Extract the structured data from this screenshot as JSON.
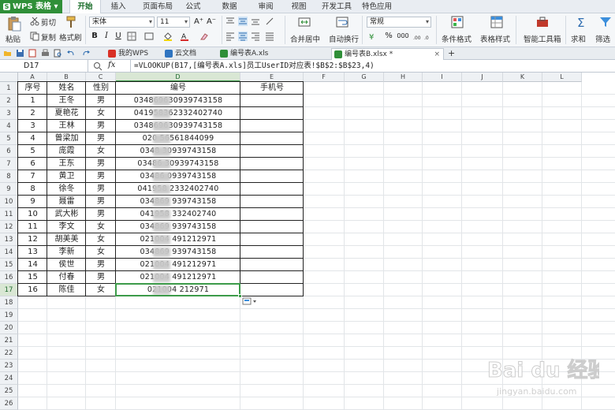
{
  "app": {
    "name": "WPS 表格"
  },
  "menu": {
    "tabs": [
      "开始",
      "插入",
      "页面布局",
      "公式",
      "数据",
      "审阅",
      "视图",
      "开发工具",
      "特色应用"
    ],
    "active": 0
  },
  "ribbon": {
    "paste": "粘贴",
    "cut": "剪切",
    "copy": "复制",
    "format_painter": "格式刷",
    "font_name": "宋体",
    "font_size": "11",
    "merge_center": "合并居中",
    "wrap_text": "自动换行",
    "number_format": "常规",
    "conditional_format": "条件格式",
    "table_style": "表格样式",
    "smart_toolbox": "智能工具箱",
    "sum": "求和",
    "filter": "筛选",
    "font_grow": "A⁺",
    "font_shrink": "A⁻",
    "bold": "B",
    "italic": "I",
    "underline": "U",
    "percent": "%",
    "comma": "000"
  },
  "doc_tabs": [
    {
      "label": "我的WPS",
      "color": "#d93025"
    },
    {
      "label": "云文档",
      "color": "#2f74c0"
    },
    {
      "label": "编号表A.xls",
      "color": "#2f8f38"
    },
    {
      "label": "编号表B.xlsx *",
      "color": "#2f8f38"
    }
  ],
  "doc_tab_close": "×",
  "doc_tab_add": "+",
  "formula_bar": {
    "cell_ref": "D17",
    "fx": "fx",
    "formula": "=VLOOKUP(B17,[编号表A.xls]员工UserID对应表!$B$2:$B$23,4)"
  },
  "columns": [
    "A",
    "B",
    "C",
    "D",
    "E",
    "F",
    "G",
    "H",
    "I",
    "J",
    "K",
    "L"
  ],
  "row_numbers": [
    "1",
    "2",
    "3",
    "4",
    "5",
    "6",
    "7",
    "8",
    "9",
    "10",
    "11",
    "12",
    "13",
    "14",
    "15",
    "16",
    "17",
    "18",
    "19",
    "20",
    "21",
    "22",
    "23",
    "24",
    "25",
    "26"
  ],
  "table": {
    "headers": [
      "序号",
      "姓名",
      "性别",
      "编号",
      "手机号"
    ],
    "rows": [
      [
        "1",
        "王冬",
        "男",
        "034869630939743158",
        ""
      ],
      [
        "2",
        "夏艳花",
        "女",
        "041958362332402740",
        ""
      ],
      [
        "3",
        "王林",
        "男",
        "034869630939743158",
        ""
      ],
      [
        "4",
        "曾梁加",
        "男",
        "020    56561844099",
        ""
      ],
      [
        "5",
        "庞霞",
        "女",
        "0348     30939743158",
        ""
      ],
      [
        "6",
        "王东",
        "男",
        "03486     30939743158",
        ""
      ],
      [
        "7",
        "黄卫",
        "男",
        "03486     0939743158",
        ""
      ],
      [
        "8",
        "徐冬",
        "男",
        "041958     2332402740",
        ""
      ],
      [
        "9",
        "聂雷",
        "男",
        "034869     939743158",
        ""
      ],
      [
        "10",
        "武大彬",
        "男",
        "041958     332402740",
        ""
      ],
      [
        "11",
        "李文",
        "女",
        "034869     939743158",
        ""
      ],
      [
        "12",
        "胡美美",
        "女",
        "021004     491212971",
        ""
      ],
      [
        "13",
        "李新",
        "女",
        "034869     939743158",
        ""
      ],
      [
        "14",
        "侯世",
        "男",
        "021004     491212971",
        ""
      ],
      [
        "15",
        "付春",
        "男",
        "021004     491212971",
        ""
      ],
      [
        "16",
        "陈佳",
        "女",
        "021004     212971",
        ""
      ]
    ]
  },
  "watermark": {
    "text": "Bai du 经验",
    "url_text": "jingyan.baidu.com"
  }
}
